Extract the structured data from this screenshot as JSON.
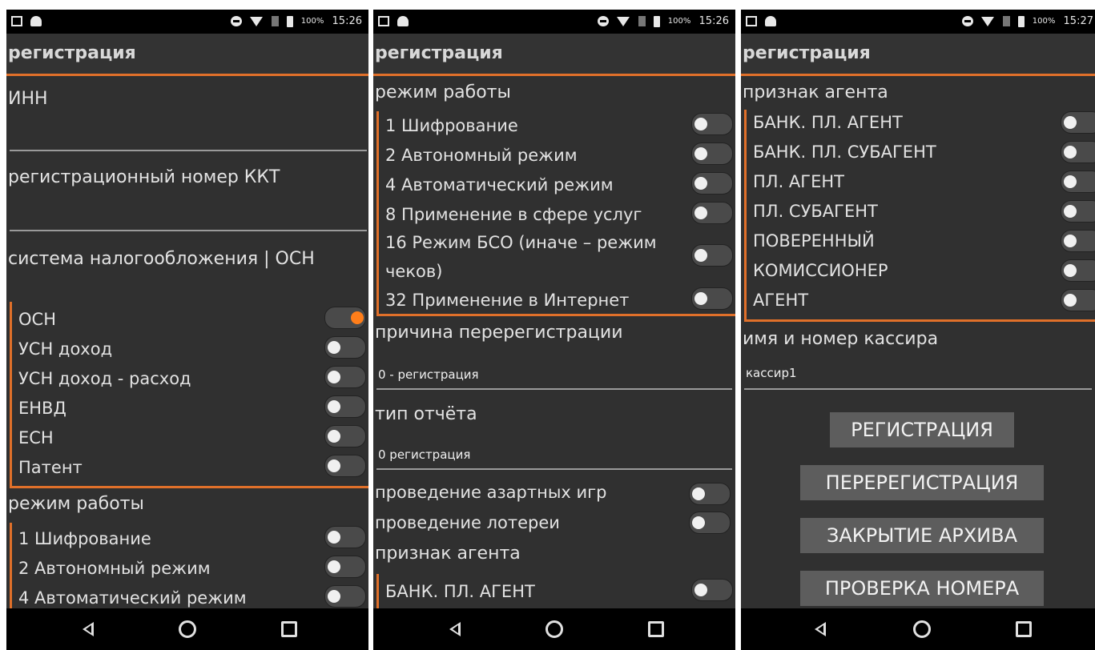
{
  "colors": {
    "accent": "#e0702a",
    "background": "#303030",
    "switch_on": "#ff7e1a"
  },
  "screens": [
    {
      "status": {
        "battery": "100%",
        "time": "15:26"
      },
      "title": "регистрация",
      "inn_label": "ИНН",
      "regnum_label": "регистрационный номер ККТ",
      "tax_label": "система налогообложения | ОСН",
      "tax_options": [
        {
          "label": "ОСН",
          "on": true
        },
        {
          "label": "УСН доход",
          "on": false
        },
        {
          "label": "УСН доход - расход",
          "on": false
        },
        {
          "label": "ЕНВД",
          "on": false
        },
        {
          "label": "ЕСН",
          "on": false
        },
        {
          "label": "Патент",
          "on": false
        }
      ],
      "mode_label": "режим работы",
      "mode_options": [
        {
          "label": "1  Шифрование",
          "on": false
        },
        {
          "label": "2  Автономный режим",
          "on": false
        },
        {
          "label": "4  Автоматический режим",
          "on": false
        }
      ]
    },
    {
      "status": {
        "battery": "100%",
        "time": "15:26"
      },
      "title": "регистрация",
      "mode_label": "режим работы",
      "mode_options": [
        {
          "label": "1  Шифрование",
          "on": false
        },
        {
          "label": "2  Автономный режим",
          "on": false
        },
        {
          "label": "4  Автоматический режим",
          "on": false
        },
        {
          "label": "8  Применение в сфере услуг",
          "on": false
        },
        {
          "label": "16 Режим БСО (иначе – режим чеков)",
          "on": false
        },
        {
          "label": "32 Применение в Интернет",
          "on": false
        }
      ],
      "rereg_label": "причина перерегистрации",
      "rereg_value": "0 - регистрация",
      "report_label": "тип отчёта",
      "report_value": "0 регистрация",
      "gambling_label": "проведение азартных игр",
      "lottery_label": "проведение лотереи",
      "agent_label": "признак агента",
      "agent_first": "БАНК. ПЛ. АГЕНТ"
    },
    {
      "status": {
        "battery": "100%",
        "time": "15:27"
      },
      "title": "регистрация",
      "agent_label": "признак агента",
      "agent_options": [
        {
          "label": "БАНК. ПЛ. АГЕНТ",
          "on": false
        },
        {
          "label": "БАНК. ПЛ. СУБАГЕНТ",
          "on": false
        },
        {
          "label": "ПЛ. АГЕНТ",
          "on": false
        },
        {
          "label": "ПЛ. СУБАГЕНТ",
          "on": false
        },
        {
          "label": "ПОВЕРЕННЫЙ",
          "on": false
        },
        {
          "label": "КОМИССИОНЕР",
          "on": false
        },
        {
          "label": "АГЕНТ",
          "on": false
        }
      ],
      "cashier_label": "имя и номер кассира",
      "cashier_value": "кассир1",
      "buttons": {
        "register": "РЕГИСТРАЦИЯ",
        "reregister": "ПЕРЕРЕГИСТРАЦИЯ",
        "close_archive": "ЗАКРЫТИЕ АРХИВА",
        "check_number": "ПРОВЕРКА НОМЕРА"
      }
    }
  ]
}
